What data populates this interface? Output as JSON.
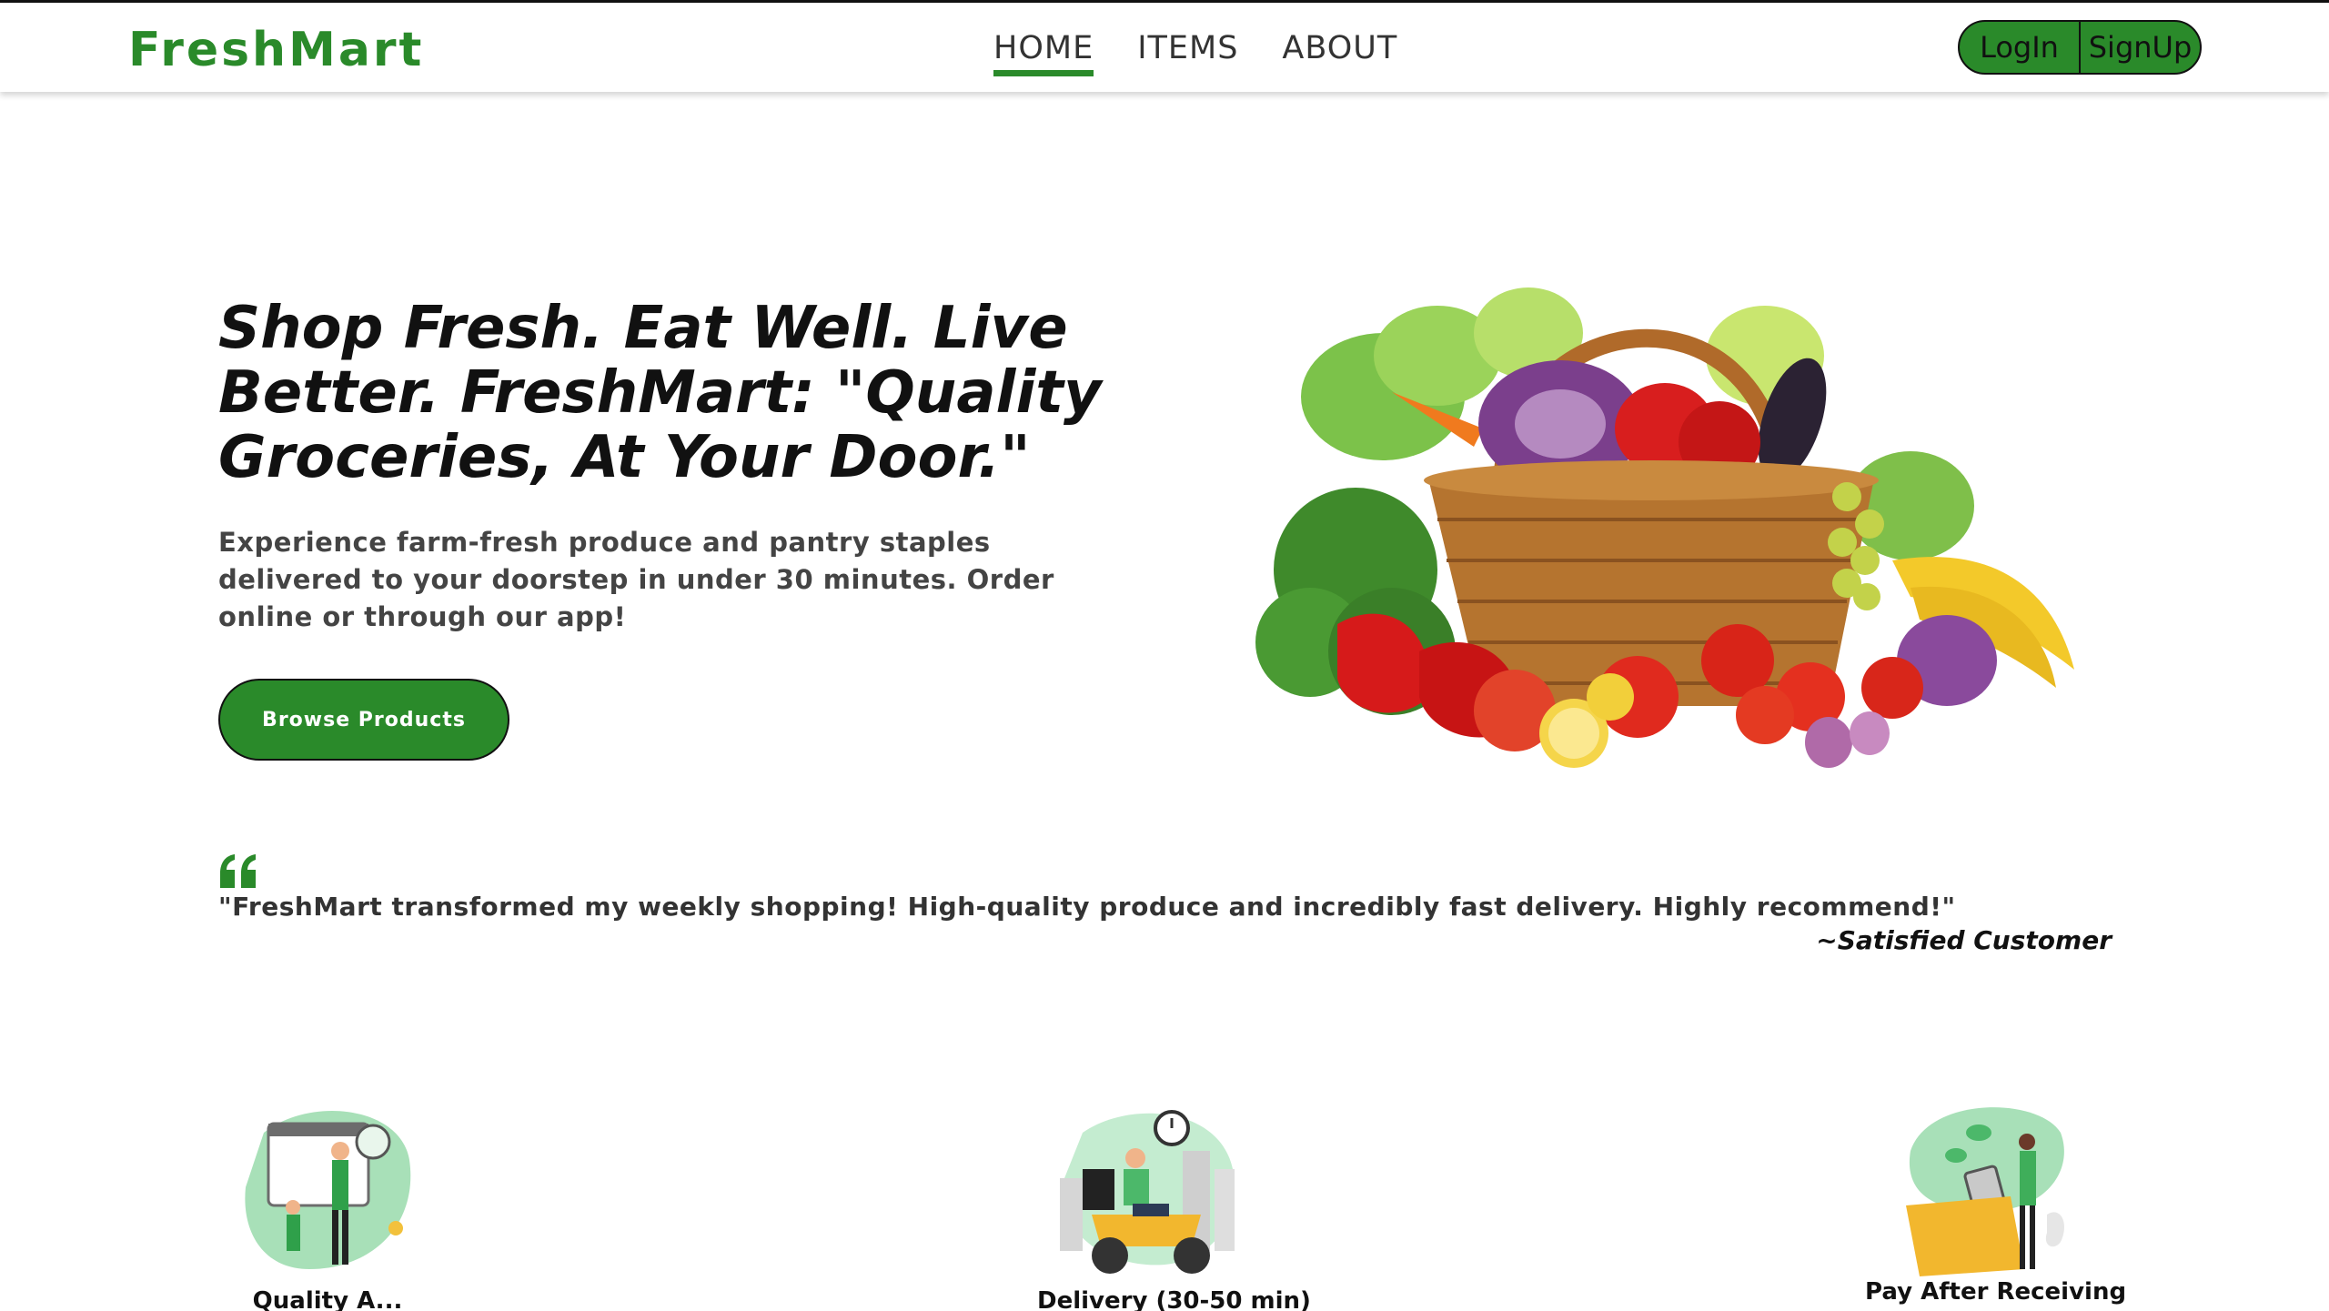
{
  "brand": {
    "logo": "FreshMart",
    "color": "#2a8a2a"
  },
  "nav": {
    "items": [
      {
        "label": "HOME",
        "active": true
      },
      {
        "label": "ITEMS",
        "active": false
      },
      {
        "label": "ABOUT",
        "active": false
      }
    ],
    "login_label": "LogIn",
    "signup_label": "SignUp"
  },
  "hero": {
    "title": "Shop Fresh. Eat Well. Live Better. FreshMart: \"Quality Groceries, At Your Door.\"",
    "subtitle": "Experience farm-fresh produce and pantry staples delivered to your doorstep in under 30 minutes. Order online or through our app!",
    "cta_label": "Browse Products",
    "image": "vegetable-basket-image"
  },
  "testimonial": {
    "icon": "quote-icon",
    "text": "\"FreshMart transformed my weekly shopping! High-quality produce and incredibly fast delivery. Highly recommend!\"",
    "author": "~Satisfied Customer"
  },
  "features": [
    {
      "icon": "quality-assurance-illustration",
      "label": "Quality A..."
    },
    {
      "icon": "delivery-scooter-illustration",
      "label": "Delivery (30-50 min)"
    },
    {
      "icon": "pay-after-receiving-illustration",
      "label": "Pay After Receiving"
    }
  ]
}
